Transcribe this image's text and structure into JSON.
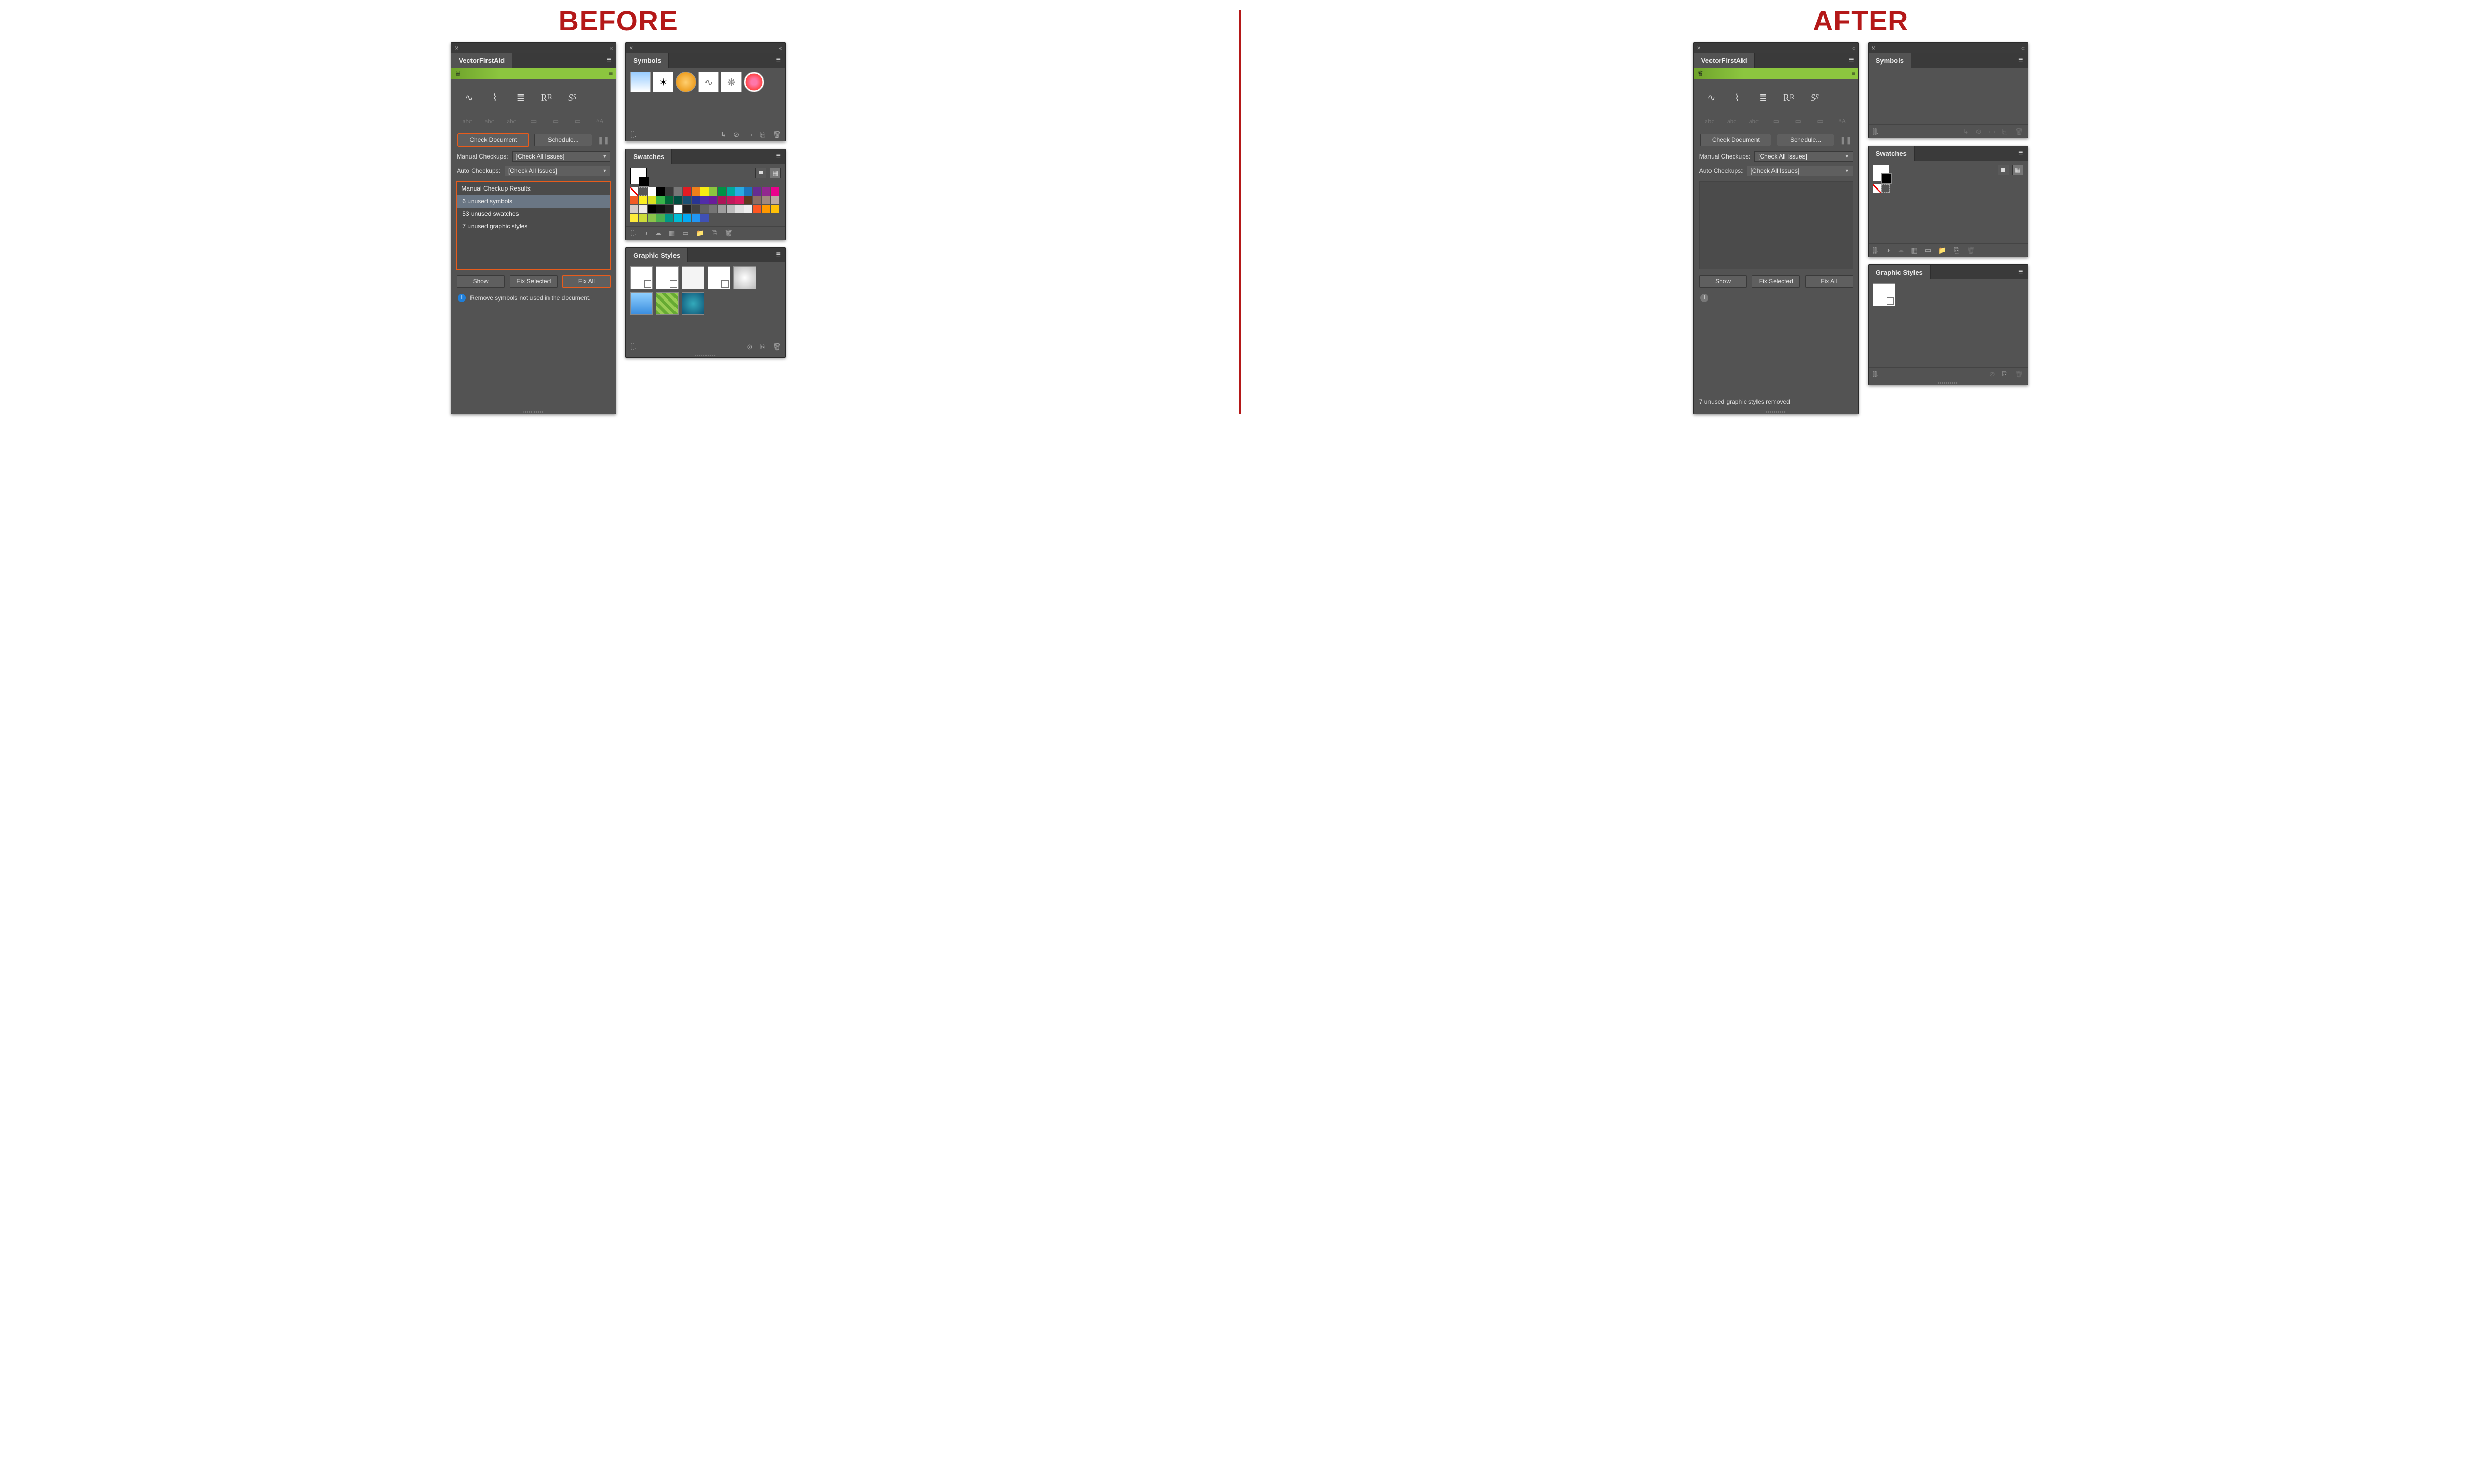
{
  "labels": {
    "before": "BEFORE",
    "after": "AFTER"
  },
  "vfa": {
    "title": "VectorFirstAid",
    "check_btn": "Check Document",
    "schedule_btn": "Schedule...",
    "manual_label": "Manual Checkups:",
    "auto_label": "Auto Checkups:",
    "check_all": "[Check All Issues]",
    "results_header": "Manual Checkup Results:",
    "results": [
      "6 unused symbols",
      "53 unused swatches",
      "7 unused graphic styles"
    ],
    "show_btn": "Show",
    "fixsel_btn": "Fix Selected",
    "fixall_btn": "Fix All",
    "hint": "Remove symbols not used in the document.",
    "after_status": "7 unused graphic styles removed"
  },
  "panels": {
    "symbols": "Symbols",
    "swatches": "Swatches",
    "styles": "Graphic Styles"
  },
  "swatch_colors_before": [
    "none",
    "reg",
    "#ffffff",
    "#000000",
    "#3a3a3a",
    "#777777",
    "#e31b23",
    "#ef7f1a",
    "#f7ec13",
    "#8cc63f",
    "#009245",
    "#00a99d",
    "#29abe2",
    "#1b75bc",
    "#662d91",
    "#92278f",
    "#ec008c",
    "#f15a24",
    "#fcee21",
    "#d9e021",
    "#39b54a",
    "#006837",
    "#004d40",
    "#1b4f72",
    "#283593",
    "#512da8",
    "#6a1b9a",
    "#ad1457",
    "#c2185b",
    "#d81b60",
    "#5c3a21",
    "#8d6e63",
    "#a1887f",
    "#bcaaa4",
    "#d7ccc8",
    "#efebe9",
    "#000000",
    "#111111",
    "#222222",
    "#ffffff",
    "#212121",
    "#424242",
    "#616161",
    "#757575",
    "#9e9e9e",
    "#bdbdbd",
    "#e0e0e0",
    "#eeeeee",
    "#ff5722",
    "#ff9800",
    "#ffc107",
    "#ffeb3b",
    "#cddc39",
    "#8bc34a",
    "#4caf50",
    "#009688",
    "#00bcd4",
    "#03a9f4",
    "#2196f3",
    "#3f51b5"
  ],
  "swatch_colors_after": [
    "none",
    "reg"
  ]
}
